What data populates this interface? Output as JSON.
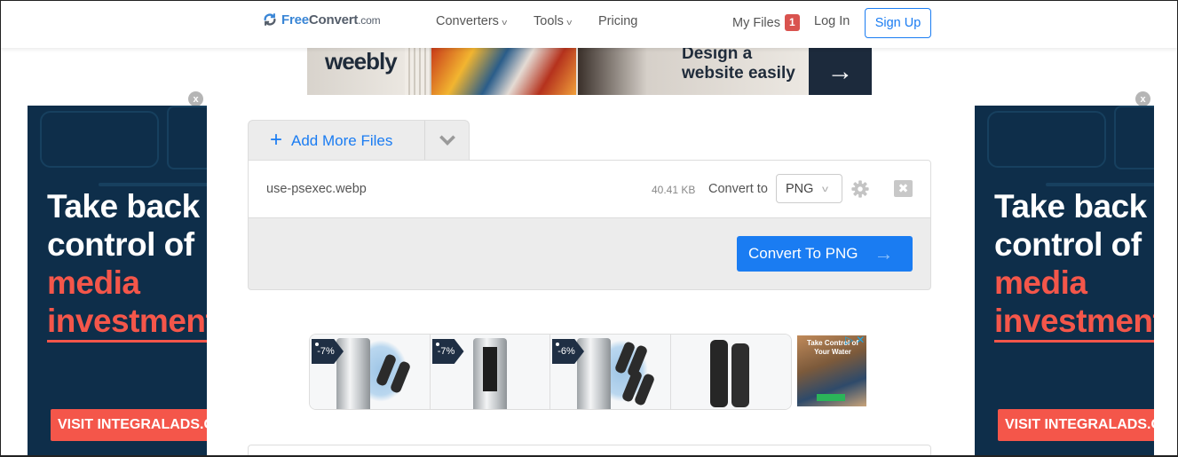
{
  "header": {
    "logo": {
      "part1": "Free",
      "part2": "Convert",
      "part3": ".com"
    },
    "nav": [
      {
        "label": "Converters",
        "dropdown": true
      },
      {
        "label": "Tools",
        "dropdown": true
      },
      {
        "label": "Pricing",
        "dropdown": false
      }
    ],
    "my_files": {
      "label": "My Files",
      "count": "1"
    },
    "login_label": "Log In",
    "signup_label": "Sign Up"
  },
  "top_banner_ad": {
    "brand": "weebly",
    "tagline_line1": "Design a",
    "tagline_line2": "website easily",
    "arrow": "→"
  },
  "side_ads": {
    "close_label": "x",
    "headline_line1": "Take back",
    "headline_line2": "control of",
    "highlight_line1": "media",
    "highlight_line2": "investment",
    "cta": "VISIT INTEGRALADS.COM"
  },
  "converter": {
    "add_files_label": "Add More Files",
    "file": {
      "name": "use-psexec.webp",
      "size": "40.41 KB",
      "convert_to_label": "Convert to",
      "format": "PNG"
    },
    "convert_button_label": "Convert To PNG",
    "colors": {
      "accent": "#1a7cf2",
      "badge": "#d9534f"
    }
  },
  "product_ads": [
    {
      "discount": "-7%",
      "type": "tank-with-filters"
    },
    {
      "discount": "-7%",
      "type": "tank-center"
    },
    {
      "discount": "-6%",
      "type": "tank-with-four-filters"
    },
    {
      "discount": "",
      "type": "two-filters"
    }
  ],
  "side_product_ad": {
    "text": "Take Control of Your Water",
    "adchoices_icon": "▷",
    "close_icon": "✕"
  }
}
